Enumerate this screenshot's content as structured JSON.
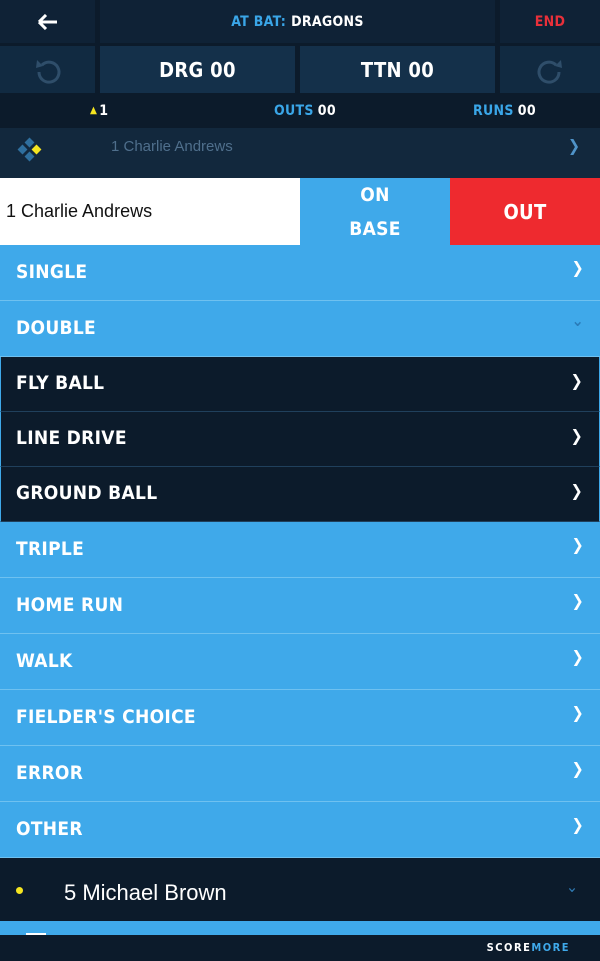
{
  "header": {
    "at_bat_label": "AT BAT:",
    "at_bat_team": "DRAGONS",
    "end_label": "END"
  },
  "score": {
    "home": "DRG 00",
    "away": "TTN 00"
  },
  "status": {
    "inning": "1",
    "outs_label": "OUTS",
    "outs_value": "00",
    "runs_label": "RUNS",
    "runs_value": "00"
  },
  "batter_bar": {
    "name": "1 Charlie Andrews"
  },
  "action": {
    "batter": "1 Charlie Andrews",
    "on_base_line1": "ON",
    "on_base_line2": "BASE",
    "out": "OUT"
  },
  "outcomes": [
    "SINGLE",
    "DOUBLE",
    "FLY BALL",
    "LINE DRIVE",
    "GROUND BALL",
    "TRIPLE",
    "HOME RUN",
    "WALK",
    "FIELDER'S CHOICE",
    "ERROR",
    "OTHER"
  ],
  "next_batter": {
    "name": "5 Michael Brown"
  },
  "footer": {
    "logo_a": "SCORE",
    "logo_b": "MORE"
  },
  "colors": {
    "accent": "#3fa9ea",
    "out_red": "#ee2a2f",
    "background": "#0c1b2b"
  }
}
